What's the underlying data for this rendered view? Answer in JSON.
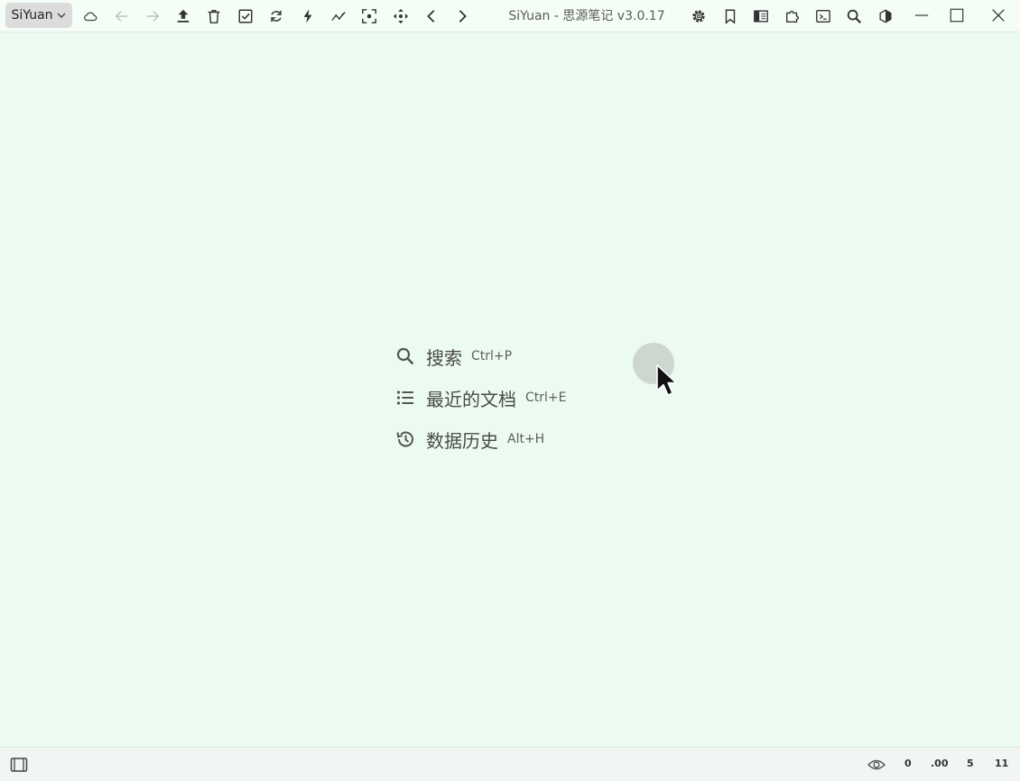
{
  "toolbar": {
    "workspace_label": "SiYuan",
    "window_title": "SiYuan - 思源笔记 v3.0.17",
    "icons": [
      "cloud-sync-icon",
      "back-icon",
      "forward-icon",
      "upload-icon",
      "trash-icon",
      "checkbox-icon",
      "refresh-icon",
      "lightning-icon",
      "graph-icon",
      "focus-icon",
      "move-icon",
      "prev-icon",
      "next-icon",
      "settings-icon",
      "bookmark-icon",
      "reader-icon",
      "plugin-icon",
      "terminal-icon",
      "search-icon",
      "theme-icon"
    ],
    "window_controls": [
      "minimize",
      "maximize",
      "close"
    ]
  },
  "center_menu": {
    "items": [
      {
        "label": "搜索",
        "shortcut": "Ctrl+P",
        "icon": "search-icon"
      },
      {
        "label": "最近的文档",
        "shortcut": "Ctrl+E",
        "icon": "list-icon"
      },
      {
        "label": "数据历史",
        "shortcut": "Alt+H",
        "icon": "history-icon"
      }
    ]
  },
  "statusbar": {
    "stats": [
      "0",
      ".00",
      "5",
      "11"
    ]
  },
  "colors": {
    "background": "#ecfbf0",
    "toolbar_bg": "#f4fdf6",
    "statusbar_bg": "#f1f6f2",
    "workspace_button_bg": "#dcdcdc"
  }
}
